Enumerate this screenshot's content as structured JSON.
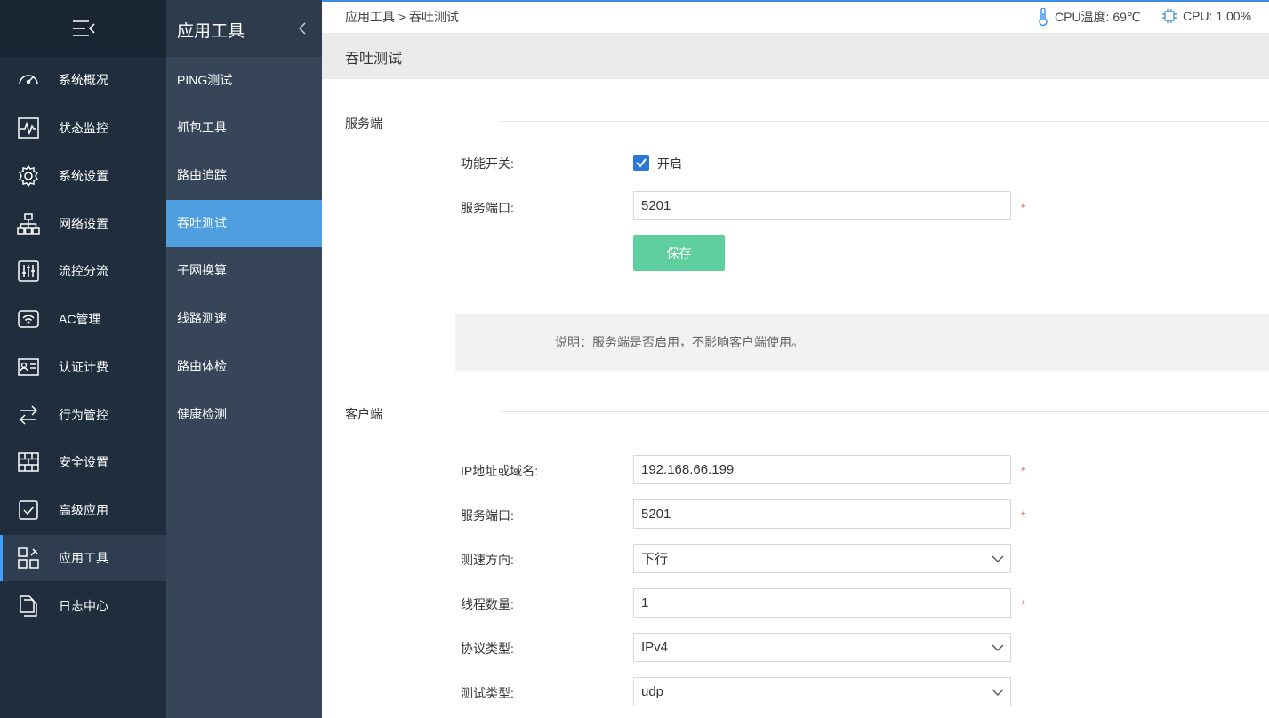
{
  "breadcrumb": {
    "parent": "应用工具",
    "separator": ">",
    "current": "吞吐测试"
  },
  "status": {
    "temp": "CPU温度: 69℃",
    "cpu": "CPU: 1.00%"
  },
  "nav": {
    "items": [
      {
        "label": "系统概况",
        "icon": "dashboard-icon"
      },
      {
        "label": "状态监控",
        "icon": "monitor-icon"
      },
      {
        "label": "系统设置",
        "icon": "gear-icon"
      },
      {
        "label": "网络设置",
        "icon": "network-icon"
      },
      {
        "label": "流控分流",
        "icon": "sliders-icon"
      },
      {
        "label": "AC管理",
        "icon": "wifi-icon"
      },
      {
        "label": "认证计费",
        "icon": "id-card-icon"
      },
      {
        "label": "行为管控",
        "icon": "arrows-icon"
      },
      {
        "label": "安全设置",
        "icon": "firewall-icon"
      },
      {
        "label": "高级应用",
        "icon": "check-doc-icon"
      },
      {
        "label": "应用工具",
        "icon": "tools-icon"
      },
      {
        "label": "日志中心",
        "icon": "log-icon"
      }
    ],
    "active_index": 10
  },
  "subnav": {
    "title": "应用工具",
    "items": [
      "PING测试",
      "抓包工具",
      "路由追踪",
      "吞吐测试",
      "子网换算",
      "线路测速",
      "路由体检",
      "健康检测"
    ],
    "active_index": 3
  },
  "page": {
    "title": "吞吐测试"
  },
  "server": {
    "section_title": "服务端",
    "switch_label": "功能开关:",
    "switch_checked": true,
    "switch_text": "开启",
    "port_label": "服务端口:",
    "port_value": "5201",
    "save_label": "保存",
    "note": "说明：服务端是否启用，不影响客户端使用。"
  },
  "client": {
    "section_title": "客户端",
    "ip_label": "IP地址或域名:",
    "ip_value": "192.168.66.199",
    "port_label": "服务端口:",
    "port_value": "5201",
    "direction_label": "测速方向:",
    "direction_value": "下行",
    "threads_label": "线程数量:",
    "threads_value": "1",
    "protocol_label": "协议类型:",
    "protocol_value": "IPv4",
    "test_type_label": "测试类型:",
    "test_type_value": "udp"
  },
  "required_mark": "*",
  "colors": {
    "accent": "#4f9fe0",
    "save_button": "#5fcf9f",
    "required": "#f56c6c",
    "checkbox": "#2b79d6"
  }
}
